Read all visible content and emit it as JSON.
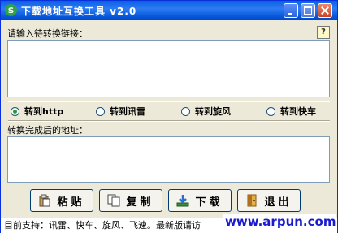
{
  "window": {
    "title": "下载地址互换工具 v2.0",
    "app_icon": "app-icon",
    "controls": [
      "minimize",
      "maximize",
      "close"
    ]
  },
  "input_section": {
    "label": "请输入待转换链接：",
    "value": "",
    "help_icon": "help-icon",
    "help_glyph": "?"
  },
  "convert_options": [
    {
      "label": "转到http",
      "selected": true
    },
    {
      "label": "转到讯雷",
      "selected": false
    },
    {
      "label": "转到旋风",
      "selected": false
    },
    {
      "label": "转到快车",
      "selected": false
    }
  ],
  "output_section": {
    "label": "转换完成后的地址：",
    "value": ""
  },
  "buttons": {
    "paste": {
      "label": "粘贴",
      "icon": "paste-icon"
    },
    "copy": {
      "label": "复制",
      "icon": "copy-icon"
    },
    "download": {
      "label": "下载",
      "icon": "download-icon"
    },
    "exit": {
      "label": "退出",
      "icon": "exit-icon"
    }
  },
  "status_bar": {
    "text": "目前支持：讯雷、快车、旋风、飞速。最新版请访",
    "watermark": "www.arpun.com"
  },
  "colors": {
    "titlebar": "#0a5fe4",
    "background": "#ece9d8",
    "radio_dot": "#21a121",
    "watermark": "#1a1ad0"
  }
}
